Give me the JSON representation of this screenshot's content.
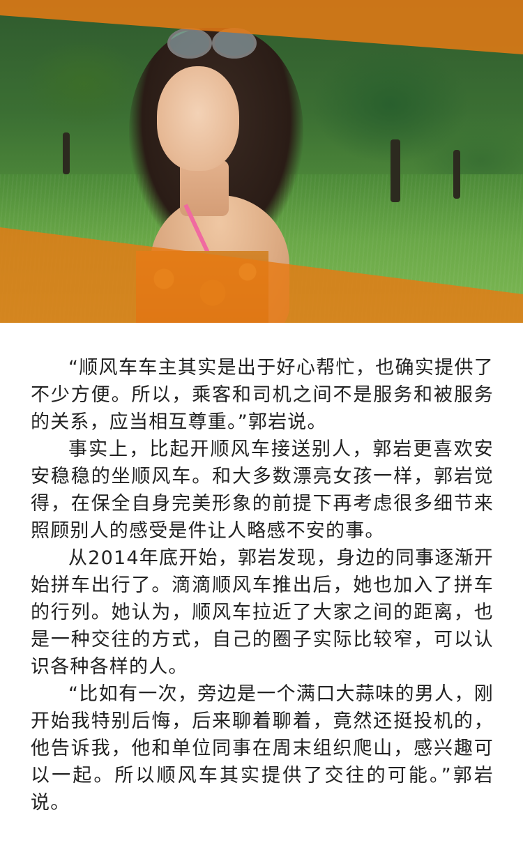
{
  "hero": {
    "image": "photo of young woman with sunglasses on head in a green orchard, orange diagonal bands overlay"
  },
  "article": {
    "paragraphs": [
      "“顺风车车主其实是出于好心帮忙，也确实提供了不少方便。所以，乘客和司机之间不是服务和被服务的关系，应当相互尊重。”郭岩说。",
      "事实上，比起开顺风车接送别人，郭岩更喜欢安安稳稳的坐顺风车。和大多数漂亮女孩一样，郭岩觉得，在保全自身完美形象的前提下再考虑很多细节来照顾别人的感受是件让人略感不安的事。",
      "从2014年底开始，郭岩发现，身边的同事逐渐开始拼车出行了。滴滴顺风车推出后，她也加入了拼车的行列。她认为，顺风车拉近了大家之间的距离，也是一种交往的方式，自己的圈子实际比较窄，可以认识各种各样的人。",
      "“比如有一次，旁边是一个满口大蒜味的男人，刚开始我特别后悔，后来聊着聊着，竟然还挺投机的，他告诉我，他和单位同事在周末组织爬山，感兴趣可以一起。所以顺风车其实提供了交往的可能。”郭岩说。"
    ]
  },
  "colors": {
    "accent_orange": "#e67a14",
    "text": "#222222",
    "background": "#ffffff"
  }
}
